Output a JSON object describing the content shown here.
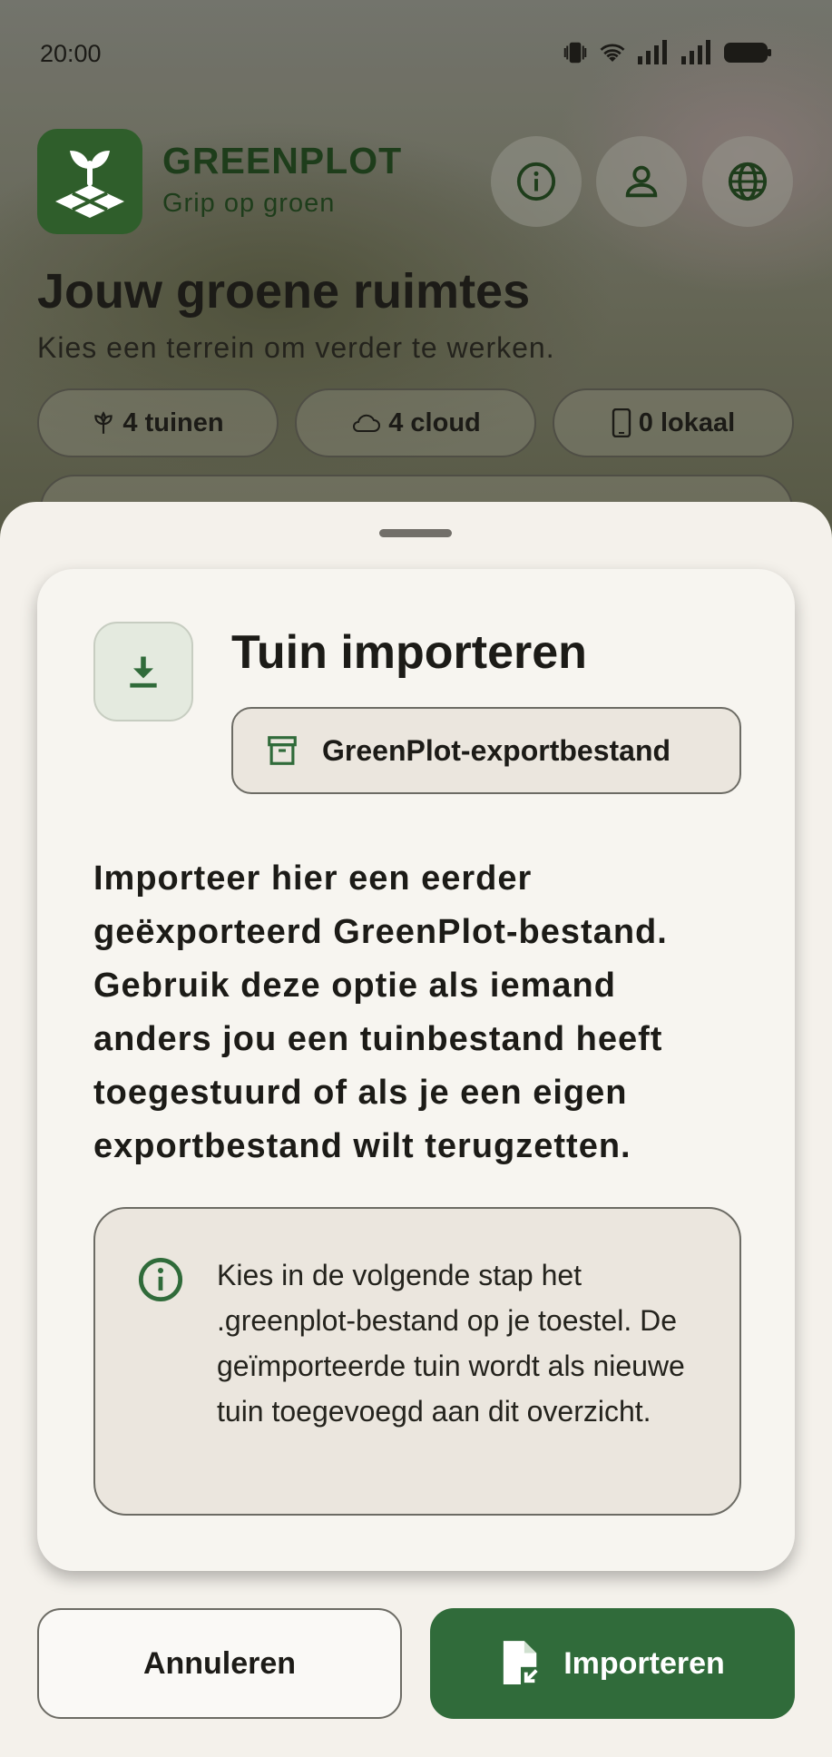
{
  "status_bar": {
    "time": "20:00"
  },
  "header": {
    "brand_name": "GREENPLOT",
    "brand_tagline": "Grip op groen",
    "actions": [
      {
        "icon": "info-icon"
      },
      {
        "icon": "person-icon"
      },
      {
        "icon": "globe-icon"
      }
    ]
  },
  "page": {
    "title": "Jouw groene ruimtes",
    "subtitle": "Kies een terrein om verder te werken.",
    "stats": [
      {
        "icon": "plant-icon",
        "label": "4 tuinen"
      },
      {
        "icon": "cloud-icon",
        "label": "4 cloud"
      },
      {
        "icon": "phone-icon",
        "label": "0 lokaal"
      }
    ]
  },
  "sheet": {
    "title": "Tuin importeren",
    "chip_label": "GreenPlot-exportbestand",
    "description": "Importeer hier een eerder geëxporteerd GreenPlot-bestand. Gebruik deze optie als iemand anders jou een tuinbestand heeft toegestuurd of als je een eigen exportbestand wilt terugzetten.",
    "info_text": "Kies in de volgende stap het .greenplot-bestand op je toestel. De geïmporteerde tuin wordt als nieuwe tuin toegevoegd aan dit overzicht.",
    "cancel_label": "Annuleren",
    "import_label": "Importeren"
  },
  "colors": {
    "primary_green": "#306b3a",
    "brand_dark_green": "#2f5e2b",
    "sheet_background": "#f4f1eb"
  }
}
